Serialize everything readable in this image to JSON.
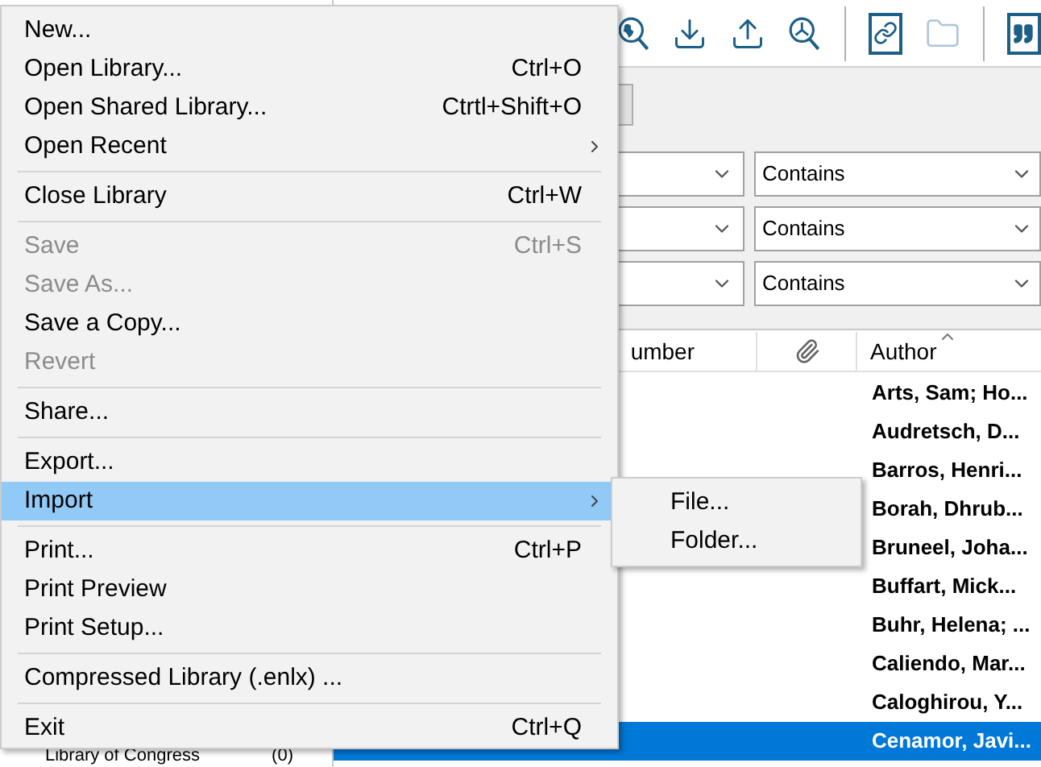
{
  "file_menu": {
    "items": [
      {
        "kind": "item",
        "label": "New...",
        "disabled": false,
        "selected": false,
        "submenu": false
      },
      {
        "kind": "item",
        "label": "Open Library...",
        "shortcut": "Ctrl+O",
        "disabled": false,
        "selected": false,
        "submenu": false
      },
      {
        "kind": "item",
        "label": "Open Shared Library...",
        "shortcut": "Ctrtl+Shift+O",
        "disabled": false,
        "selected": false,
        "submenu": false
      },
      {
        "kind": "item",
        "label": "Open Recent",
        "disabled": false,
        "selected": false,
        "submenu": true
      },
      {
        "kind": "separator"
      },
      {
        "kind": "item",
        "label": "Close Library",
        "shortcut": "Ctrl+W",
        "disabled": false,
        "selected": false,
        "submenu": false
      },
      {
        "kind": "separator"
      },
      {
        "kind": "item",
        "label": "Save",
        "shortcut": "Ctrl+S",
        "disabled": true,
        "selected": false,
        "submenu": false
      },
      {
        "kind": "item",
        "label": "Save As...",
        "disabled": true,
        "selected": false,
        "submenu": false
      },
      {
        "kind": "item",
        "label": "Save a Copy...",
        "disabled": false,
        "selected": false,
        "submenu": false
      },
      {
        "kind": "item",
        "label": "Revert",
        "disabled": true,
        "selected": false,
        "submenu": false
      },
      {
        "kind": "separator"
      },
      {
        "kind": "item",
        "label": "Share...",
        "disabled": false,
        "selected": false,
        "submenu": false
      },
      {
        "kind": "separator"
      },
      {
        "kind": "item",
        "label": "Export...",
        "disabled": false,
        "selected": false,
        "submenu": false
      },
      {
        "kind": "item",
        "label": "Import",
        "disabled": false,
        "selected": true,
        "submenu": true
      },
      {
        "kind": "separator"
      },
      {
        "kind": "item",
        "label": "Print...",
        "shortcut": "Ctrl+P",
        "disabled": false,
        "selected": false,
        "submenu": false
      },
      {
        "kind": "item",
        "label": "Print Preview",
        "disabled": false,
        "selected": false,
        "submenu": false
      },
      {
        "kind": "item",
        "label": "Print Setup...",
        "disabled": false,
        "selected": false,
        "submenu": false
      },
      {
        "kind": "separator"
      },
      {
        "kind": "item",
        "label": "Compressed Library (.enlx) ...",
        "disabled": false,
        "selected": false,
        "submenu": false
      },
      {
        "kind": "separator"
      },
      {
        "kind": "item",
        "label": "Exit",
        "shortcut": "Ctrl+Q",
        "disabled": false,
        "selected": false,
        "submenu": false
      }
    ]
  },
  "import_submenu": {
    "items": [
      "File...",
      "Folder..."
    ]
  },
  "search_rows": [
    {
      "operator": "Contains"
    },
    {
      "operator": "Contains"
    },
    {
      "operator": "Contains"
    }
  ],
  "table": {
    "columns": [
      "umber",
      "Author"
    ],
    "rows": [
      {
        "author": "Arts, Sam; Ho...",
        "selected": false
      },
      {
        "author": "Audretsch, D...",
        "selected": false
      },
      {
        "author": "Barros, Henri...",
        "selected": false
      },
      {
        "author": "Borah, Dhrub...",
        "selected": false
      },
      {
        "author": "Bruneel, Joha...",
        "selected": false
      },
      {
        "author": "Buffart, Mick...",
        "selected": false
      },
      {
        "author": "Buhr, Helena; ...",
        "selected": false
      },
      {
        "author": "Caliendo, Mar...",
        "selected": false
      },
      {
        "author": "Caloghirou, Y...",
        "selected": false
      },
      {
        "author": "Cenamor, Javi...",
        "selected": true
      }
    ]
  },
  "sidebar": {
    "items": [
      {
        "label": "Library of Congress",
        "count": "(0)"
      }
    ]
  }
}
